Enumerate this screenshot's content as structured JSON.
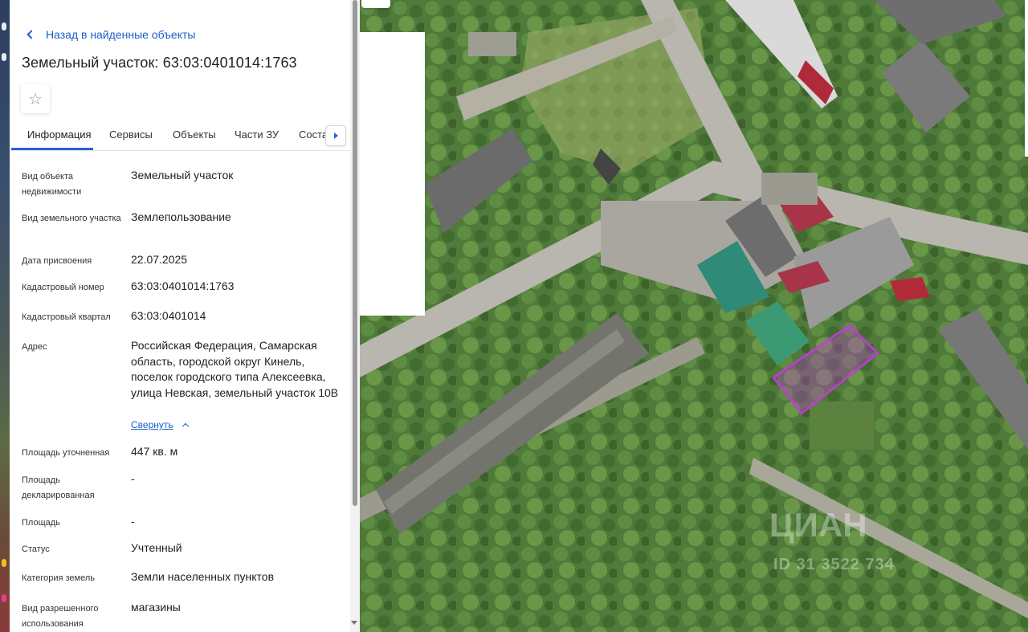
{
  "nav": {
    "back_label": "Назад в найденные объекты"
  },
  "object": {
    "title": "Земельный участок: 63:03:0401014:1763"
  },
  "tabs": [
    {
      "label": "Информация"
    },
    {
      "label": "Сервисы"
    },
    {
      "label": "Объекты"
    },
    {
      "label": "Части ЗУ"
    },
    {
      "label": "Соста"
    }
  ],
  "fields": [
    {
      "label": "Вид объекта недвижимости",
      "value": "Земельный участок"
    },
    {
      "label": "Вид земельного участка",
      "value": "Землепользование"
    },
    {
      "label": "Дата присвоения",
      "value": "22.07.2025"
    },
    {
      "label": "Кадастровый номер",
      "value": "63:03:0401014:1763"
    },
    {
      "label": "Кадастровый квартал",
      "value": "63:03:0401014"
    },
    {
      "label": "Адрес",
      "value": "Российская Федерация, Самарская область, городской округ Кинель, поселок городского типа Алексеевка, улица Невская, земельный участок 10В"
    },
    {
      "label": "Площадь уточненная",
      "value": "447 кв. м"
    },
    {
      "label": "Площадь декларированная",
      "value": "-"
    },
    {
      "label": "Площадь",
      "value": "-"
    },
    {
      "label": "Статус",
      "value": "Учтенный"
    },
    {
      "label": "Категория земель",
      "value": "Земли населенных пунктов"
    },
    {
      "label": "Вид разрешенного использования",
      "value": "магазины"
    }
  ],
  "address_collapse_label": "Свернуть",
  "map": {
    "parcel_color": "#c23bd6",
    "watermark": "ЦИАН",
    "watermark_sub": "ID 31 3522 734"
  }
}
